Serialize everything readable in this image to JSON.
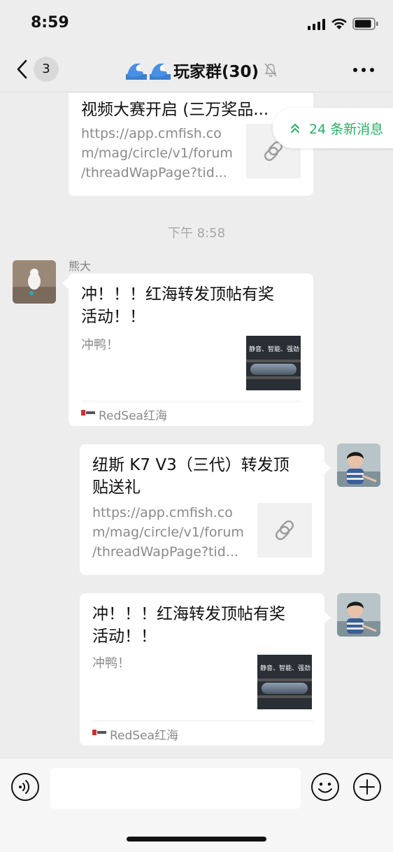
{
  "status": {
    "time": "8:59"
  },
  "nav": {
    "unread_count": "3",
    "title": "玩家群(30)"
  },
  "new_messages": {
    "label": "24 条新消息"
  },
  "messages": [
    {
      "title_partial": "视频大赛开启 (三万奖品...",
      "url_lines": [
        "https://app.cmfish.co",
        "m/mag/circle/v1/forum",
        "/threadWapPage?tid..."
      ]
    },
    {
      "timestamp": "下午 8:58"
    },
    {
      "sender": "熊大",
      "title_lines": [
        "冲！！！红海转发顶帖有奖",
        "活动！！"
      ],
      "desc": "冲鸭！",
      "thumb_text": "静音、智能、强劲",
      "source": "RedSea红海"
    },
    {
      "title_lines": [
        "纽斯 K7 V3（三代）转发顶",
        "贴送礼"
      ],
      "url_lines": [
        "https://app.cmfish.co",
        "m/mag/circle/v1/forum",
        "/threadWapPage?tid..."
      ]
    },
    {
      "title_lines": [
        "冲！！！红海转发顶帖有奖",
        "活动！！"
      ],
      "desc": "冲鸭！",
      "thumb_text": "静音、智能、强劲",
      "source": "RedSea红海"
    }
  ],
  "input": {
    "value": ""
  },
  "colors": {
    "accent": "#2aae67",
    "background": "#ededed",
    "bubble": "#ffffff"
  },
  "icons": [
    "back-icon",
    "mute-icon",
    "more-icon",
    "link-icon",
    "voice-icon",
    "emoji-icon",
    "plus-icon",
    "double-chevron-up-icon"
  ]
}
